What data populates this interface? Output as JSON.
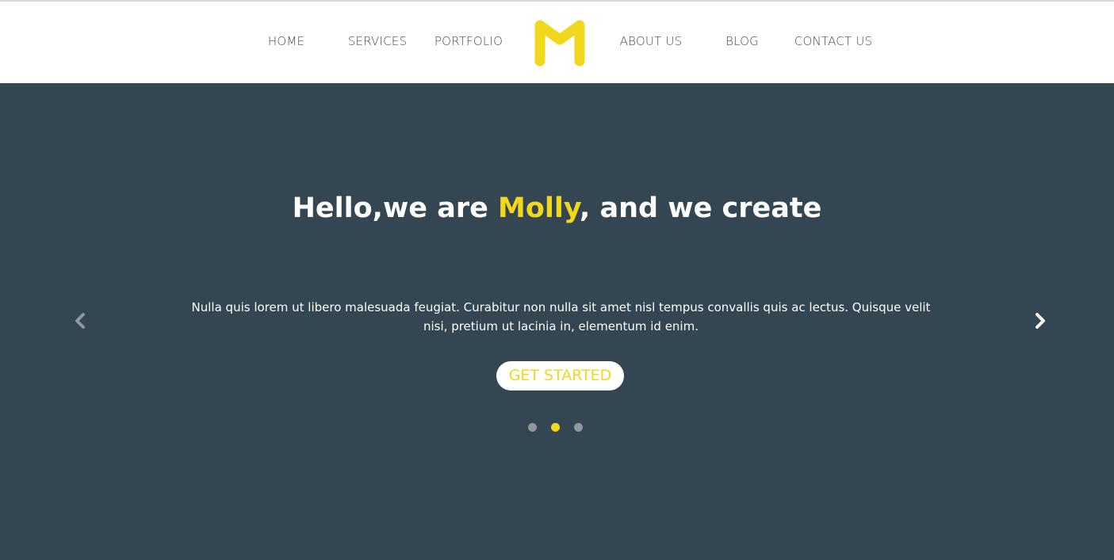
{
  "nav": {
    "items": [
      {
        "label": "HOME"
      },
      {
        "label": "SERVICES"
      },
      {
        "label": "PORTFOLIO"
      },
      {
        "label": "ABOUT US"
      },
      {
        "label": "BLOG"
      },
      {
        "label": "CONTACT US"
      }
    ],
    "logo_icon": "m-logo-icon"
  },
  "hero": {
    "headline_prefix": "Hello,we are ",
    "headline_name": "Molly",
    "headline_suffix": ", and we create",
    "description": "Nulla quis lorem ut libero malesuada feugiat. Curabitur non nulla sit amet nisl tempus convallis quis ac lectus. Quisque velit nisi, pretium ut lacinia in, elementum id enim.",
    "cta_label": "GET STARTED",
    "prev_icon": "chevron-left-icon",
    "next_icon": "chevron-right-icon",
    "slides_total": 3,
    "active_slide": 2
  },
  "colors": {
    "accent": "#f2d81c",
    "hero_background": "#344651",
    "header_background": "#ffffff",
    "nav_text": "#4a4a4a",
    "dot_inactive": "#8e989e"
  }
}
